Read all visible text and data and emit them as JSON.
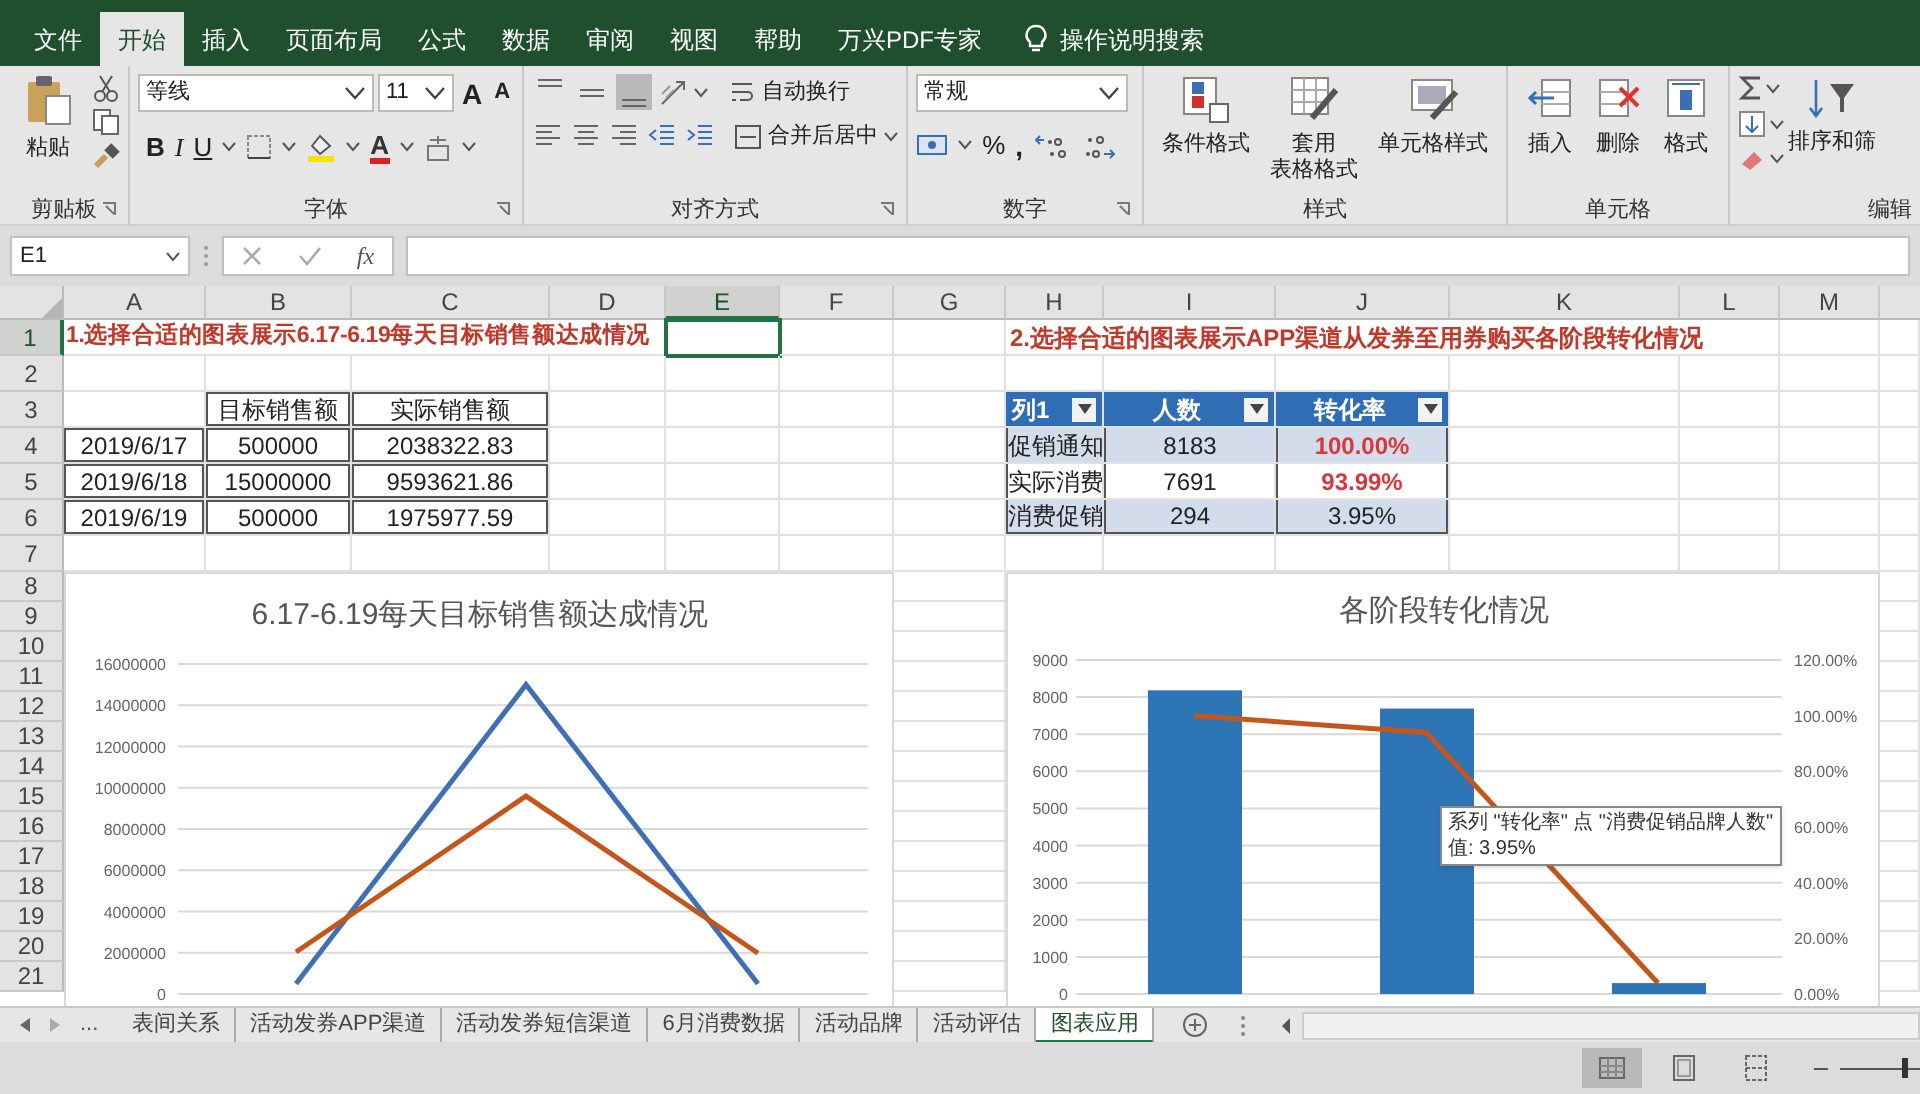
{
  "menu_tabs": [
    {
      "label": "文件",
      "selected": false
    },
    {
      "label": "开始",
      "selected": true
    },
    {
      "label": "插入",
      "selected": false
    },
    {
      "label": "页面布局",
      "selected": false
    },
    {
      "label": "公式",
      "selected": false
    },
    {
      "label": "数据",
      "selected": false
    },
    {
      "label": "审阅",
      "selected": false
    },
    {
      "label": "视图",
      "selected": false
    },
    {
      "label": "帮助",
      "selected": false
    },
    {
      "label": "万兴PDF专家",
      "selected": false
    }
  ],
  "tell_me": "操作说明搜索",
  "ribbon": {
    "clipboard": {
      "label": "剪贴板",
      "paste": "粘贴"
    },
    "font": {
      "label": "字体",
      "font_name": "等线",
      "font_size": "11",
      "grow": "A",
      "shrink": "A",
      "styles": [
        "B",
        "I",
        "U"
      ],
      "font_color": "A"
    },
    "alignment": {
      "label": "对齐方式",
      "vertical_align": [
        {
          "selected": false
        },
        {
          "selected": false
        },
        {
          "selected": true
        }
      ],
      "wrap_text": "自动换行",
      "merge_center": "合并后居中"
    },
    "number": {
      "label": "数字",
      "format": "常规",
      "symbols": [
        "%",
        ","
      ]
    },
    "styles": {
      "label": "样式",
      "buttons": [
        {
          "lines": [
            "条件格式"
          ]
        },
        {
          "lines": [
            "套用",
            "表格格式"
          ]
        },
        {
          "lines": [
            "单元格样式"
          ]
        }
      ]
    },
    "cells": {
      "label": "单元格",
      "buttons": [
        "插入",
        "删除",
        "格式"
      ]
    },
    "editing": {
      "label": "编辑",
      "sort_filter": "排序和筛"
    }
  },
  "formula_bar": {
    "name_box": "E1",
    "fx": "fx"
  },
  "sheet": {
    "columns": [
      {
        "label": "A",
        "selected": false
      },
      {
        "label": "B",
        "selected": false
      },
      {
        "label": "C",
        "selected": false
      },
      {
        "label": "D",
        "selected": false
      },
      {
        "label": "E",
        "selected": true
      },
      {
        "label": "F",
        "selected": false
      },
      {
        "label": "G",
        "selected": false
      },
      {
        "label": "H",
        "selected": false
      },
      {
        "label": "I",
        "selected": false
      },
      {
        "label": "J",
        "selected": false
      },
      {
        "label": "K",
        "selected": false
      },
      {
        "label": "L",
        "selected": false
      },
      {
        "label": "M",
        "selected": false
      }
    ],
    "rows": [
      {
        "label": "1",
        "selected": true
      },
      {
        "label": "2",
        "selected": false
      },
      {
        "label": "3",
        "selected": false
      },
      {
        "label": "4",
        "selected": false
      },
      {
        "label": "5",
        "selected": false
      },
      {
        "label": "6",
        "selected": false
      },
      {
        "label": "7",
        "selected": false
      },
      {
        "label": "8",
        "selected": false
      },
      {
        "label": "9",
        "selected": false
      },
      {
        "label": "10",
        "selected": false
      },
      {
        "label": "11",
        "selected": false
      },
      {
        "label": "12",
        "selected": false
      },
      {
        "label": "13",
        "selected": false
      },
      {
        "label": "14",
        "selected": false
      },
      {
        "label": "15",
        "selected": false
      },
      {
        "label": "16",
        "selected": false
      },
      {
        "label": "17",
        "selected": false
      },
      {
        "label": "18",
        "selected": false
      },
      {
        "label": "19",
        "selected": false
      },
      {
        "label": "20",
        "selected": false
      },
      {
        "label": "21",
        "selected": false
      }
    ]
  },
  "task_1": {
    "title": "1.选择合适的图表展示6.17-6.19每天目标销售额达成情况",
    "table": {
      "columns": [
        "目标销售额",
        "实际销售额"
      ],
      "rows": [
        {
          "date": "2019/6/17",
          "target": "500000",
          "actual": "2038322.83"
        },
        {
          "date": "2019/6/18",
          "target": "15000000",
          "actual": "9593621.86"
        },
        {
          "date": "2019/6/19",
          "target": "500000",
          "actual": "1975977.59"
        }
      ]
    },
    "chart_data": {
      "type": "line",
      "title": "6.17-6.19每天目标销售额达成情况",
      "grid": true,
      "ylim": [
        0,
        16000000
      ],
      "yticks": [
        0,
        2000000,
        4000000,
        6000000,
        8000000,
        10000000,
        12000000,
        14000000,
        16000000
      ],
      "series": [
        {
          "color": "#3f6fb5",
          "values": [
            500000,
            15000000,
            500000
          ]
        },
        {
          "color": "#c5561b",
          "values": [
            2038322.83,
            9593621.86,
            1975977.59
          ]
        }
      ]
    }
  },
  "task_2": {
    "title": "2.选择合适的图表展示APP渠道从发券至用券购买各阶段转化情况",
    "table": {
      "columns": [
        "列1",
        "人数",
        "转化率"
      ],
      "rows": [
        {
          "stage": "促销通知",
          "count": "8183",
          "rate": "100.00%",
          "highlight": true
        },
        {
          "stage": "实际消费",
          "count": "7691",
          "rate": "93.99%",
          "highlight": true
        },
        {
          "stage": "消费促销",
          "count": "294",
          "rate": "3.95%",
          "highlight": false
        }
      ]
    },
    "chart_data": {
      "type": "bar",
      "title": "各阶段转化情况",
      "grid": true,
      "ylim": [
        0,
        9000
      ],
      "y2lim": [
        0,
        1.2
      ],
      "yticks": [
        0,
        1000,
        2000,
        3000,
        4000,
        5000,
        6000,
        7000,
        8000,
        9000
      ],
      "y2ticks": [
        {
          "value": 0,
          "label": "0.00%"
        },
        {
          "value": 0.2,
          "label": "20.00%"
        },
        {
          "value": 0.4,
          "label": "40.00%"
        },
        {
          "value": 0.6,
          "label": "60.00%"
        },
        {
          "value": 0.8,
          "label": "80.00%"
        },
        {
          "value": 1,
          "label": "100.00%"
        },
        {
          "value": 1.2,
          "label": "120.00%"
        }
      ],
      "series": [
        {
          "type": "bar",
          "color": "#2e75b6",
          "values": [
            8183,
            7691,
            294
          ]
        },
        {
          "type": "line",
          "axis": "y2",
          "color": "#c5561b",
          "values": [
            1,
            0.9399,
            0.0395
          ]
        }
      ]
    },
    "tooltip": [
      "系列 \"转化率\" 点 \"消费促销品牌人数\"",
      "值: 3.95%"
    ]
  },
  "sheet_tabs": {
    "more": "...",
    "tabs": [
      {
        "label": "表间关系",
        "selected": false
      },
      {
        "label": "活动发券APP渠道",
        "selected": false
      },
      {
        "label": "活动发券短信渠道",
        "selected": false
      },
      {
        "label": "6月消费数据",
        "selected": false
      },
      {
        "label": "活动品牌",
        "selected": false
      },
      {
        "label": "活动评估",
        "selected": false
      },
      {
        "label": "图表应用",
        "selected": true
      }
    ]
  },
  "status_bar": {
    "views": [
      {
        "selected": true
      },
      {
        "selected": false
      },
      {
        "selected": false
      }
    ],
    "zoom": {
      "level": 0.85
    }
  }
}
